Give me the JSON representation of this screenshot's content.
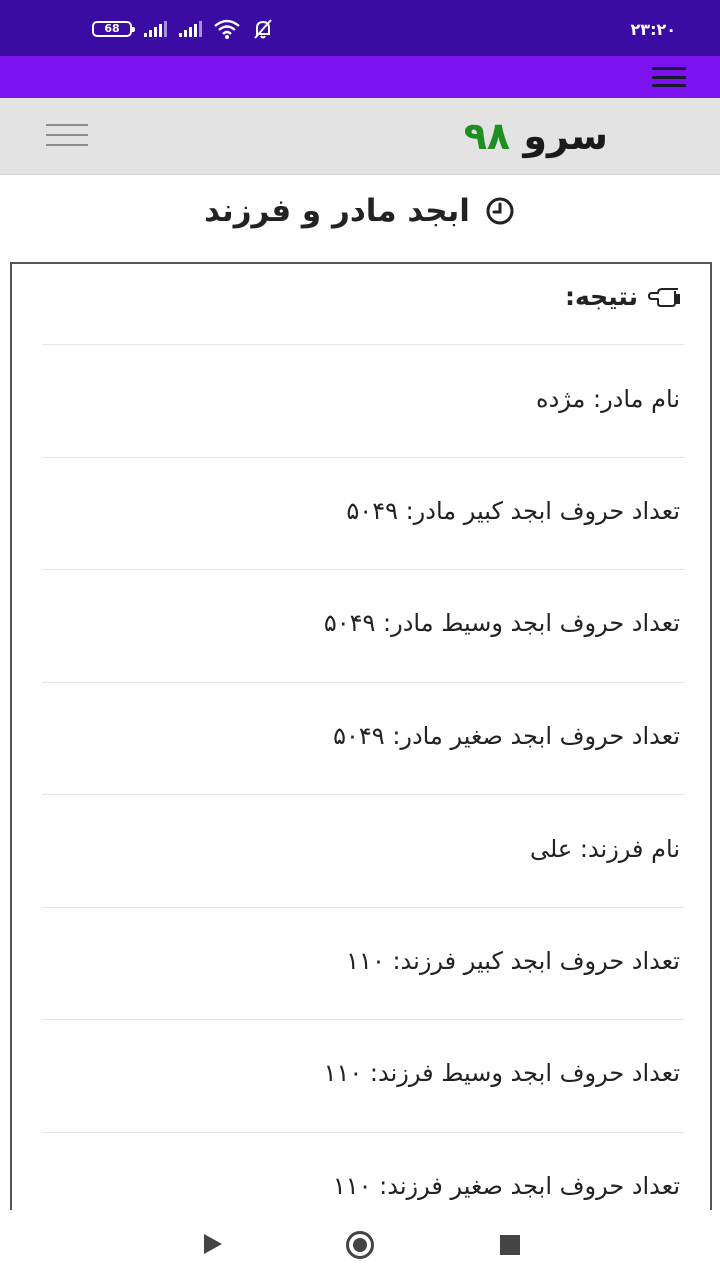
{
  "status_bar": {
    "battery": "68",
    "time": "۲۳:۲۰"
  },
  "header": {
    "logo_word": "سرو",
    "logo_number": "۹۸"
  },
  "page": {
    "title": "ابجد مادر و فرزند"
  },
  "result": {
    "label": "نتیجه:",
    "rows": [
      "نام مادر: مژده",
      "تعداد حروف ابجد کبیر مادر: ۵۰۴۹",
      "تعداد حروف ابجد وسیط مادر: ۵۰۴۹",
      "تعداد حروف ابجد صغیر مادر: ۵۰۴۹",
      "نام فرزند: علی",
      "تعداد حروف ابجد کبیر فرزند: ۱۱۰",
      "تعداد حروف ابجد وسیط فرزند: ۱۱۰",
      "تعداد حروف ابجد صغیر فرزند: ۱۱۰"
    ]
  },
  "colors": {
    "status_bar": "#3a0ca3",
    "accent_bar": "#7c12f0",
    "logo_green": "#1f8f1f",
    "header_bg": "#e3e3e3"
  }
}
